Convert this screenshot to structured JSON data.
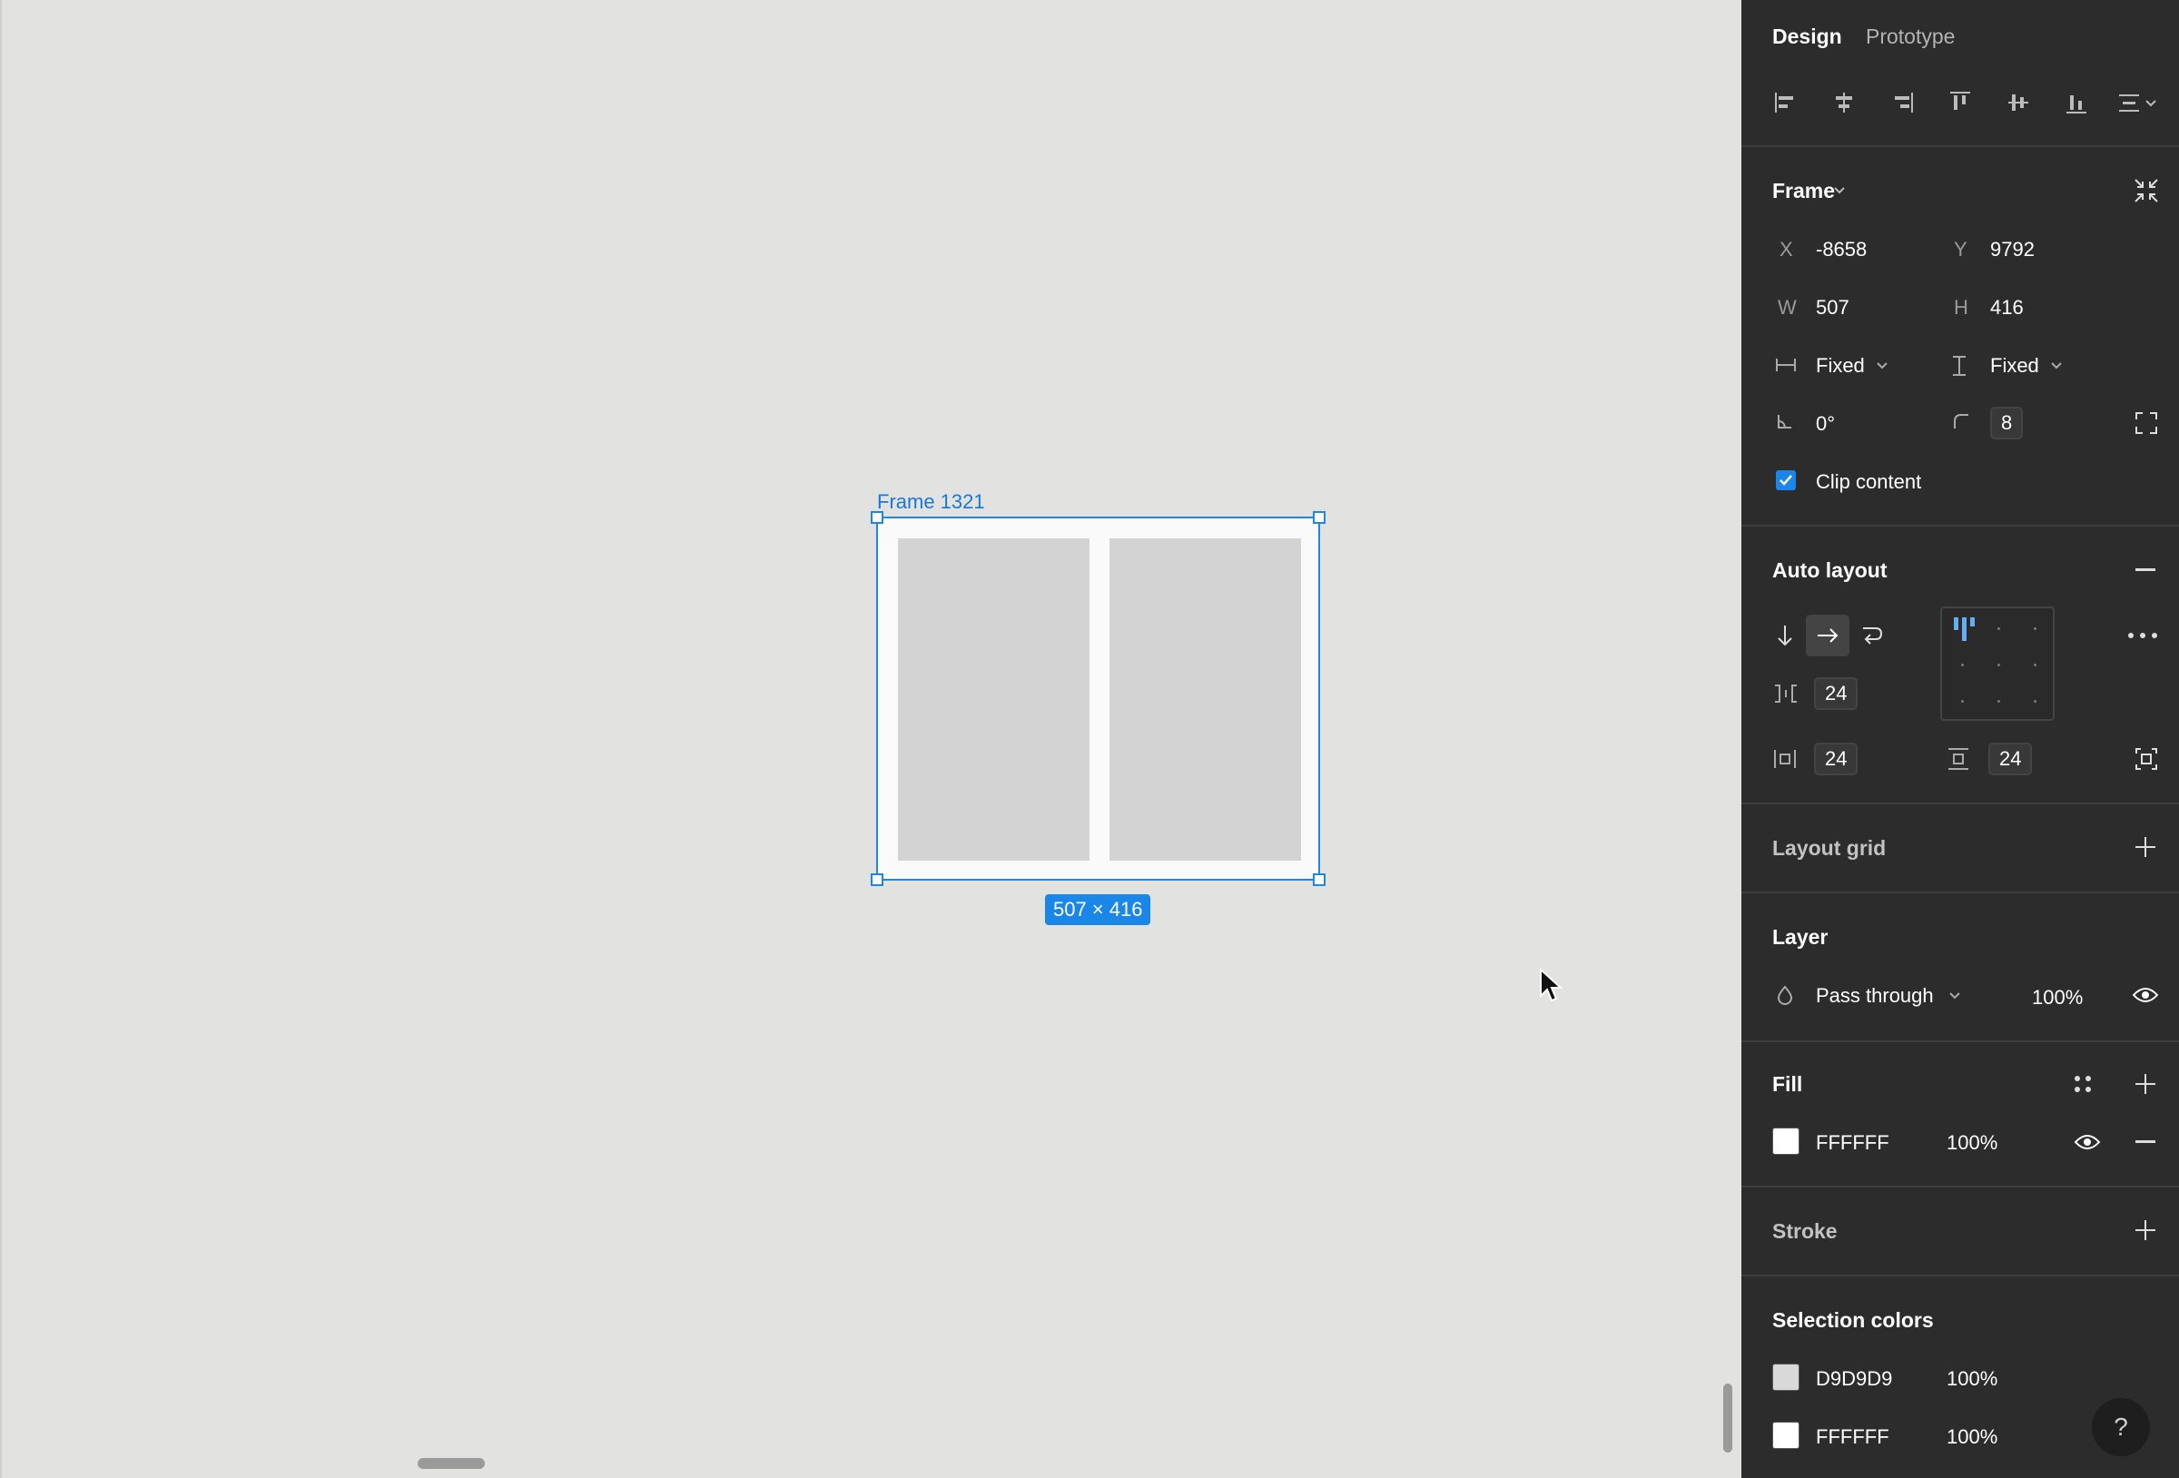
{
  "tabs": {
    "design": "Design",
    "prototype": "Prototype"
  },
  "canvas": {
    "frame_label": "Frame 1321",
    "size_badge": "507 × 416"
  },
  "frame_section": {
    "title": "Frame",
    "x_label": "X",
    "x_value": "-8658",
    "y_label": "Y",
    "y_value": "9792",
    "w_label": "W",
    "w_value": "507",
    "h_label": "H",
    "h_value": "416",
    "width_mode": "Fixed",
    "height_mode": "Fixed",
    "rotation": "0°",
    "corner_radius": "8",
    "clip_content_label": "Clip content",
    "clip_content_checked": true
  },
  "auto_layout": {
    "title": "Auto layout",
    "gap": "24",
    "padding_horizontal": "24",
    "padding_vertical": "24"
  },
  "layout_grid": {
    "title": "Layout grid"
  },
  "layer": {
    "title": "Layer",
    "blend_mode": "Pass through",
    "opacity": "100%"
  },
  "fill": {
    "title": "Fill",
    "hex": "FFFFFF",
    "opacity": "100%",
    "color": "#FFFFFF"
  },
  "stroke": {
    "title": "Stroke"
  },
  "selection_colors": {
    "title": "Selection colors",
    "items": [
      {
        "hex": "D9D9D9",
        "opacity": "100%",
        "color": "#D9D9D9"
      },
      {
        "hex": "FFFFFF",
        "opacity": "100%",
        "color": "#FFFFFF"
      }
    ]
  },
  "help": {
    "label": "?"
  },
  "colors": {
    "accent": "#1B85E8",
    "panel_bg": "#2C2C2C",
    "canvas_bg": "#E2E2E1"
  }
}
